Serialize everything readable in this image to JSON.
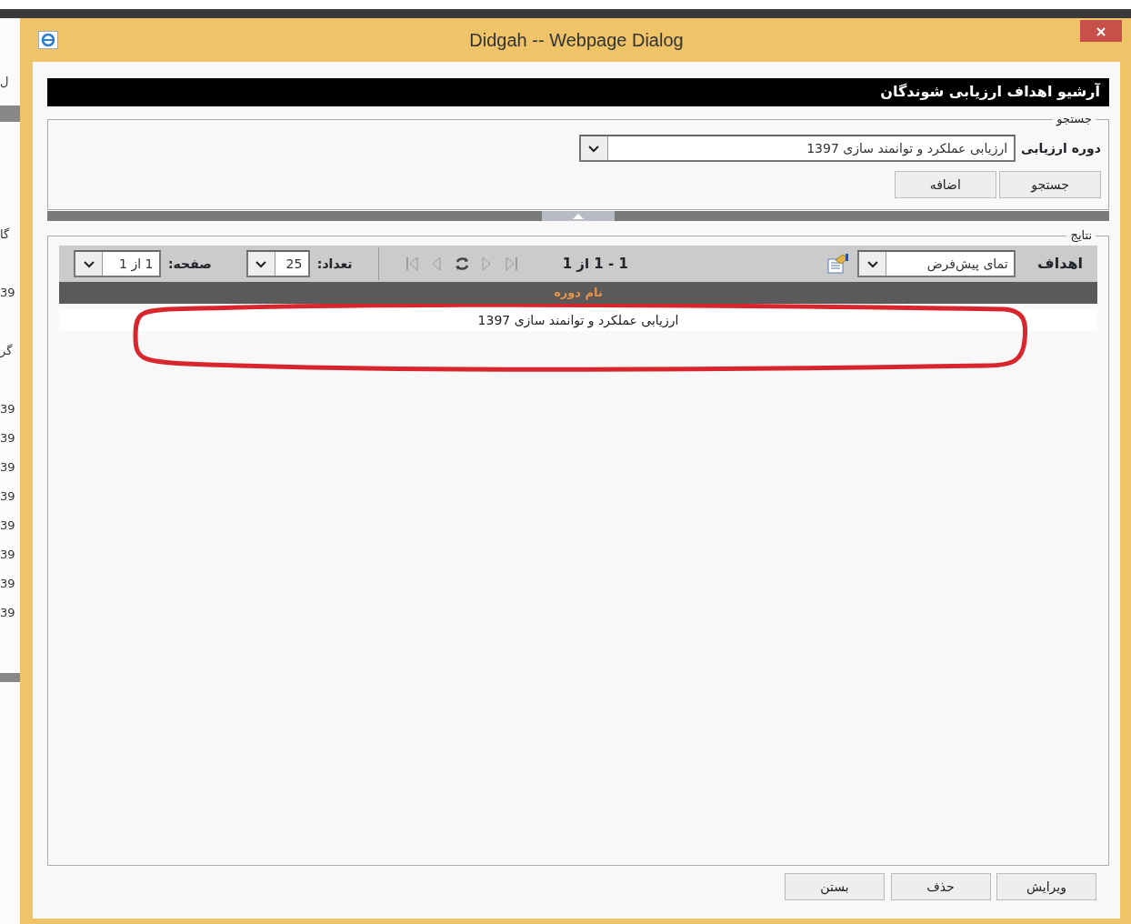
{
  "background_window": {
    "fragments": [
      "ل",
      "گا",
      "39",
      "گر",
      "39",
      "39",
      "39",
      "39",
      "39",
      "39",
      "39",
      "39"
    ]
  },
  "window": {
    "title": "Didgah -- Webpage Dialog"
  },
  "page_title": "آرشیو اهداف ارزیابی شوندگان",
  "search": {
    "legend": "جستجو",
    "field_label": "دوره ارزیابی",
    "field_value": "ارزیابی عملکرد و توانمند سازی 1397",
    "buttons": [
      "جستجو",
      "اضافه"
    ]
  },
  "results": {
    "legend": "نتایج",
    "title": "اهداف",
    "view_select": "تمای پیش‌فرض",
    "range": "1 - 1 از 1",
    "pager_buttons": [
      {
        "kind": "first",
        "disabled": true
      },
      {
        "kind": "prev",
        "disabled": true
      },
      {
        "kind": "refresh",
        "disabled": false
      },
      {
        "kind": "next",
        "disabled": true
      },
      {
        "kind": "last",
        "disabled": true
      }
    ],
    "count_label": "تعداد:",
    "count_value": "25",
    "page_label": "صفحه:",
    "page_value": "1 از 1",
    "columns": [
      "نام دوره"
    ],
    "rows": [
      [
        "ارزیابی عملکرد و توانمند سازی 1397"
      ]
    ]
  },
  "buttons": [
    "ویرایش",
    "حذف",
    "بستن"
  ]
}
